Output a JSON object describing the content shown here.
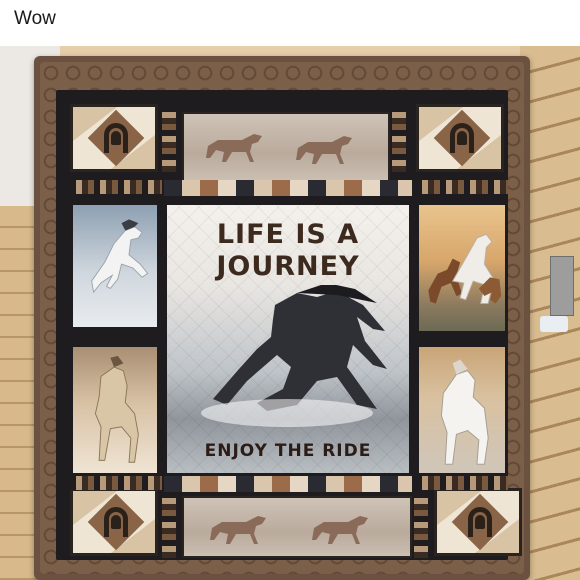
{
  "post": {
    "caption": "Wow"
  },
  "quilt": {
    "title_line1": "LIFE IS A",
    "title_line2": "JOURNEY",
    "subtitle": "ENJOY THE RIDE"
  },
  "colors": {
    "quilt_border": "#7b5f49",
    "headline_text": "#3d2a1f",
    "horse_silhouette": "#8a6a58"
  },
  "icons": [
    "horseshoe-icon",
    "horse-silhouette"
  ]
}
